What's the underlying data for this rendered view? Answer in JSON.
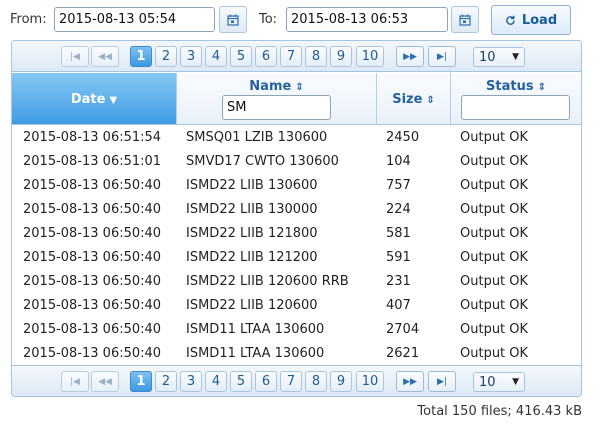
{
  "filters": {
    "from_label": "From:",
    "from_value": "2015-08-13 05:54",
    "to_label": "To:",
    "to_value": "2015-08-13 06:53",
    "load_label": "Load"
  },
  "pager": {
    "pages": [
      "1",
      "2",
      "3",
      "4",
      "5",
      "6",
      "7",
      "8",
      "9",
      "10"
    ],
    "current_page": "1",
    "page_size": "10",
    "first_glyph": "|◀",
    "prev_glyph": "◀◀",
    "next_glyph": "▶▶",
    "last_glyph": "▶|"
  },
  "columns": {
    "date": "Date",
    "name": "Name",
    "size": "Size",
    "status": "Status"
  },
  "column_filters": {
    "name": "SM",
    "status": ""
  },
  "rows": [
    {
      "date": "2015-08-13 06:51:54",
      "name": "SMSQ01 LZIB 130600",
      "size": "2450",
      "status": "Output OK"
    },
    {
      "date": "2015-08-13 06:51:01",
      "name": "SMVD17 CWTO 130600",
      "size": "104",
      "status": "Output OK"
    },
    {
      "date": "2015-08-13 06:50:40",
      "name": "ISMD22 LIIB 130600",
      "size": "757",
      "status": "Output OK"
    },
    {
      "date": "2015-08-13 06:50:40",
      "name": "ISMD22 LIIB 130000",
      "size": "224",
      "status": "Output OK"
    },
    {
      "date": "2015-08-13 06:50:40",
      "name": "ISMD22 LIIB 121800",
      "size": "581",
      "status": "Output OK"
    },
    {
      "date": "2015-08-13 06:50:40",
      "name": "ISMD22 LIIB 121200",
      "size": "591",
      "status": "Output OK"
    },
    {
      "date": "2015-08-13 06:50:40",
      "name": "ISMD22 LIIB 120600 RRB",
      "size": "231",
      "status": "Output OK"
    },
    {
      "date": "2015-08-13 06:50:40",
      "name": "ISMD22 LIIB 120600",
      "size": "407",
      "status": "Output OK"
    },
    {
      "date": "2015-08-13 06:50:40",
      "name": "ISMD11 LTAA 130600",
      "size": "2704",
      "status": "Output OK"
    },
    {
      "date": "2015-08-13 06:50:40",
      "name": "ISMD11 LTAA 130600",
      "size": "2621",
      "status": "Output OK"
    }
  ],
  "summary": {
    "total": "Total 150 files;  416.43 kB"
  },
  "colors": {
    "accent": "#3f9de3",
    "border": "#a6c3df",
    "header_text": "#2561a0"
  }
}
